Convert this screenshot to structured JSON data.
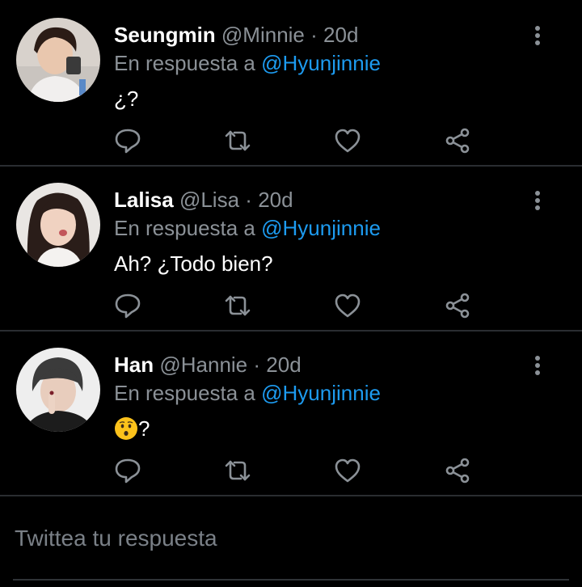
{
  "replies": [
    {
      "name": "Seungmin",
      "handle": "@Minnie",
      "separator": "·",
      "time": "20d",
      "reply_prefix": "En respuesta a ",
      "reply_to": "@Hyunjinnie",
      "text": "¿?"
    },
    {
      "name": "Lalisa",
      "handle": "@Lisa",
      "separator": "·",
      "time": "20d",
      "reply_prefix": "En respuesta a ",
      "reply_to": "@Hyunjinnie",
      "text": "Ah? ¿Todo bien?"
    },
    {
      "name": "Han",
      "handle": "@Hannie",
      "separator": "·",
      "time": "20d",
      "reply_prefix": "En respuesta a ",
      "reply_to": "@Hyunjinnie",
      "text": "?",
      "emoji": "hushed-face-emoji"
    }
  ],
  "compose": {
    "placeholder": "Twittea tu respuesta"
  },
  "icons": {
    "reply": "reply-icon",
    "retweet": "retweet-icon",
    "like": "heart-icon",
    "share": "share-icon",
    "more": "more-vertical-icon"
  },
  "colors": {
    "background": "#000000",
    "mention": "#1d9bf0",
    "muted": "#8b9197",
    "icon": "#8b9197"
  }
}
